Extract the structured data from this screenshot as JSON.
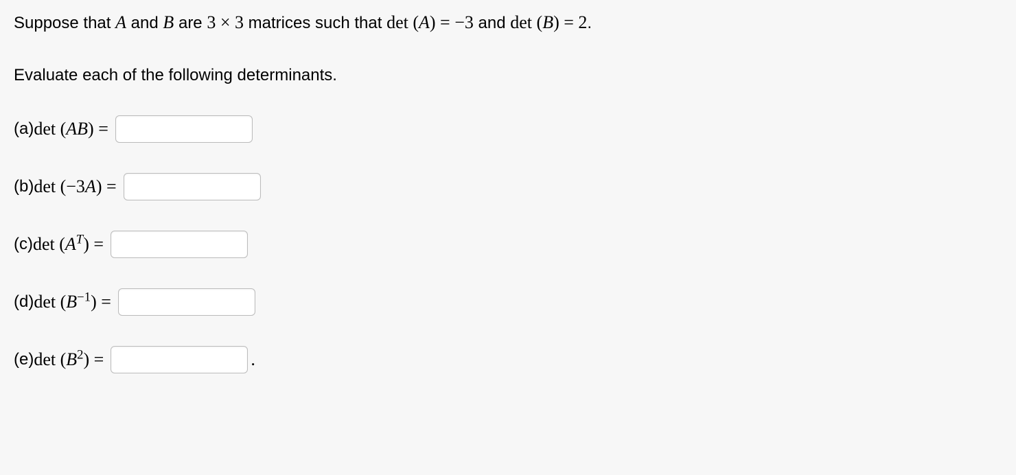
{
  "intro": {
    "part1": "Suppose that ",
    "A": "A",
    "and": " and ",
    "B": "B",
    "are": " are ",
    "dim": "3 × 3",
    "matrices_such": " matrices such that ",
    "detA_lhs": "det (A) = −3",
    "and2": " and ",
    "detB_lhs": "det (B) = 2",
    "period": "."
  },
  "instruction": "Evaluate each of the following determinants.",
  "questions": {
    "a": {
      "label": "(a) ",
      "expr_pre": "det (",
      "expr_mid": "AB",
      "expr_post": ") = "
    },
    "b": {
      "label": "(b) ",
      "expr_pre": "det (−3",
      "expr_mid": "A",
      "expr_post": ") = "
    },
    "c": {
      "label": "(c) ",
      "expr_pre": "det (",
      "expr_mid": "A",
      "sup": "T",
      "expr_post": ") = "
    },
    "d": {
      "label": "(d) ",
      "expr_pre": "det (",
      "expr_mid": "B",
      "sup": "−1",
      "expr_post": ") = "
    },
    "e": {
      "label": "(e) ",
      "expr_pre": "det (",
      "expr_mid": "B",
      "sup": "2",
      "expr_post": ") = "
    }
  },
  "trailing_period": "."
}
